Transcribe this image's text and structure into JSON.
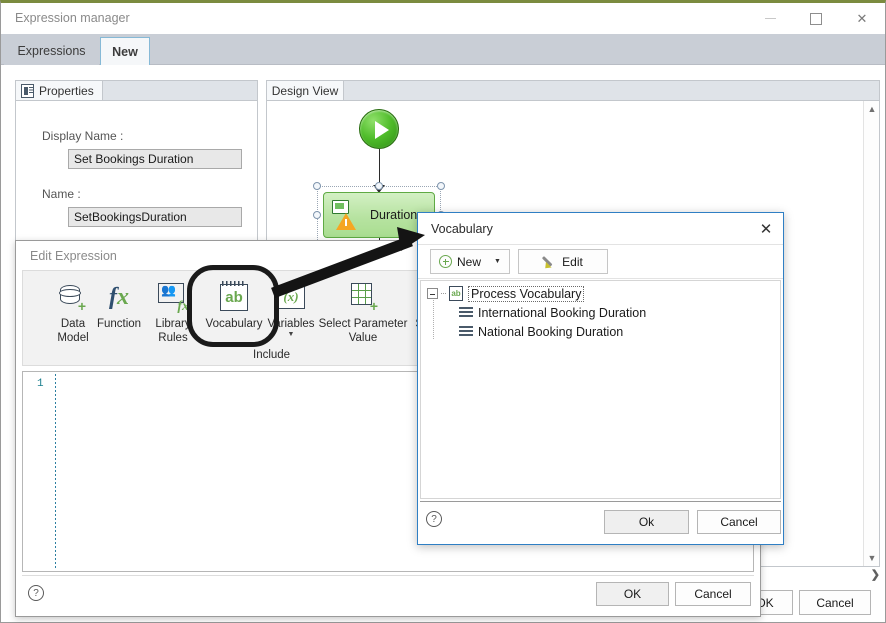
{
  "window": {
    "title": "Expression manager",
    "controls": {
      "minimize": "minimize-icon",
      "maximize": "maximize-icon",
      "close": "close-icon"
    },
    "accent_color": "#7b8b3f"
  },
  "tabs": [
    {
      "label": "Expressions",
      "active": false
    },
    {
      "label": "New",
      "active": true
    }
  ],
  "properties_panel": {
    "tab_label": "Properties",
    "tab_icon": "document-icon",
    "fields": [
      {
        "label": "Display Name :",
        "value": "Set Bookings Duration"
      },
      {
        "label": "Name :",
        "value": "SetBookingsDuration"
      }
    ]
  },
  "design_view": {
    "tab_label": "Design View",
    "nodes": [
      {
        "type": "start",
        "icon": "play-icon",
        "label": ""
      },
      {
        "type": "activity",
        "icon": "monitor-icon",
        "warning_icon": "warning-triangle-icon",
        "label": "Duration",
        "selected": true
      }
    ],
    "scroll_up": "chevron-up-icon",
    "scroll_down": "chevron-down-icon",
    "scroll_right": "chevron-right-icon"
  },
  "edit_expression": {
    "title": "Edit Expression",
    "ribbon": {
      "group_label": "Include",
      "items": [
        {
          "label_line1": "Data",
          "label_line2": "Model",
          "icon": "database-add-icon",
          "has_caret": false,
          "highlighted": false
        },
        {
          "label_line1": "Function",
          "label_line2": "",
          "icon": "function-fx-icon",
          "has_caret": false,
          "highlighted": false
        },
        {
          "label_line1": "Library",
          "label_line2": "Rules",
          "icon": "library-rules-icon",
          "has_caret": false,
          "highlighted": false
        },
        {
          "label_line1": "Vocabulary",
          "label_line2": "",
          "icon": "vocabulary-ab-icon",
          "has_caret": false,
          "highlighted": true
        },
        {
          "label_line1": "Variables",
          "label_line2": "",
          "icon": "variables-x-icon",
          "has_caret": true,
          "highlighted": false
        },
        {
          "label_line1": "Select Parameter",
          "label_line2": "Value",
          "icon": "grid-add-icon",
          "has_caret": false,
          "highlighted": false
        },
        {
          "label_line1": "Syntax",
          "label_line2": "",
          "icon": "syntax-icon",
          "has_caret": false,
          "highlighted": false
        }
      ]
    },
    "editor": {
      "line_number": "1",
      "content": ""
    },
    "footer": {
      "help_icon": "help-icon",
      "ok_label": "OK",
      "cancel_label": "Cancel"
    }
  },
  "vocabulary_dialog": {
    "title": "Vocabulary",
    "close_icon": "close-icon",
    "border_color": "#2f7fc4",
    "toolbar": [
      {
        "label": "New",
        "icon": "plus-circle-icon",
        "has_caret": true
      },
      {
        "label": "Edit",
        "icon": "pencil-icon",
        "has_caret": false
      }
    ],
    "tree": {
      "root": {
        "label": "Process Vocabulary",
        "icon": "vocabulary-book-icon",
        "expanded": true,
        "selected": true
      },
      "children": [
        {
          "label": "International Booking Duration",
          "icon": "list-lines-icon"
        },
        {
          "label": "National Booking Duration",
          "icon": "list-lines-icon"
        }
      ]
    },
    "footer": {
      "help_icon": "help-icon",
      "ok_label": "Ok",
      "cancel_label": "Cancel"
    }
  },
  "main_footer": {
    "ok_label": "OK",
    "cancel_label": "Cancel"
  }
}
